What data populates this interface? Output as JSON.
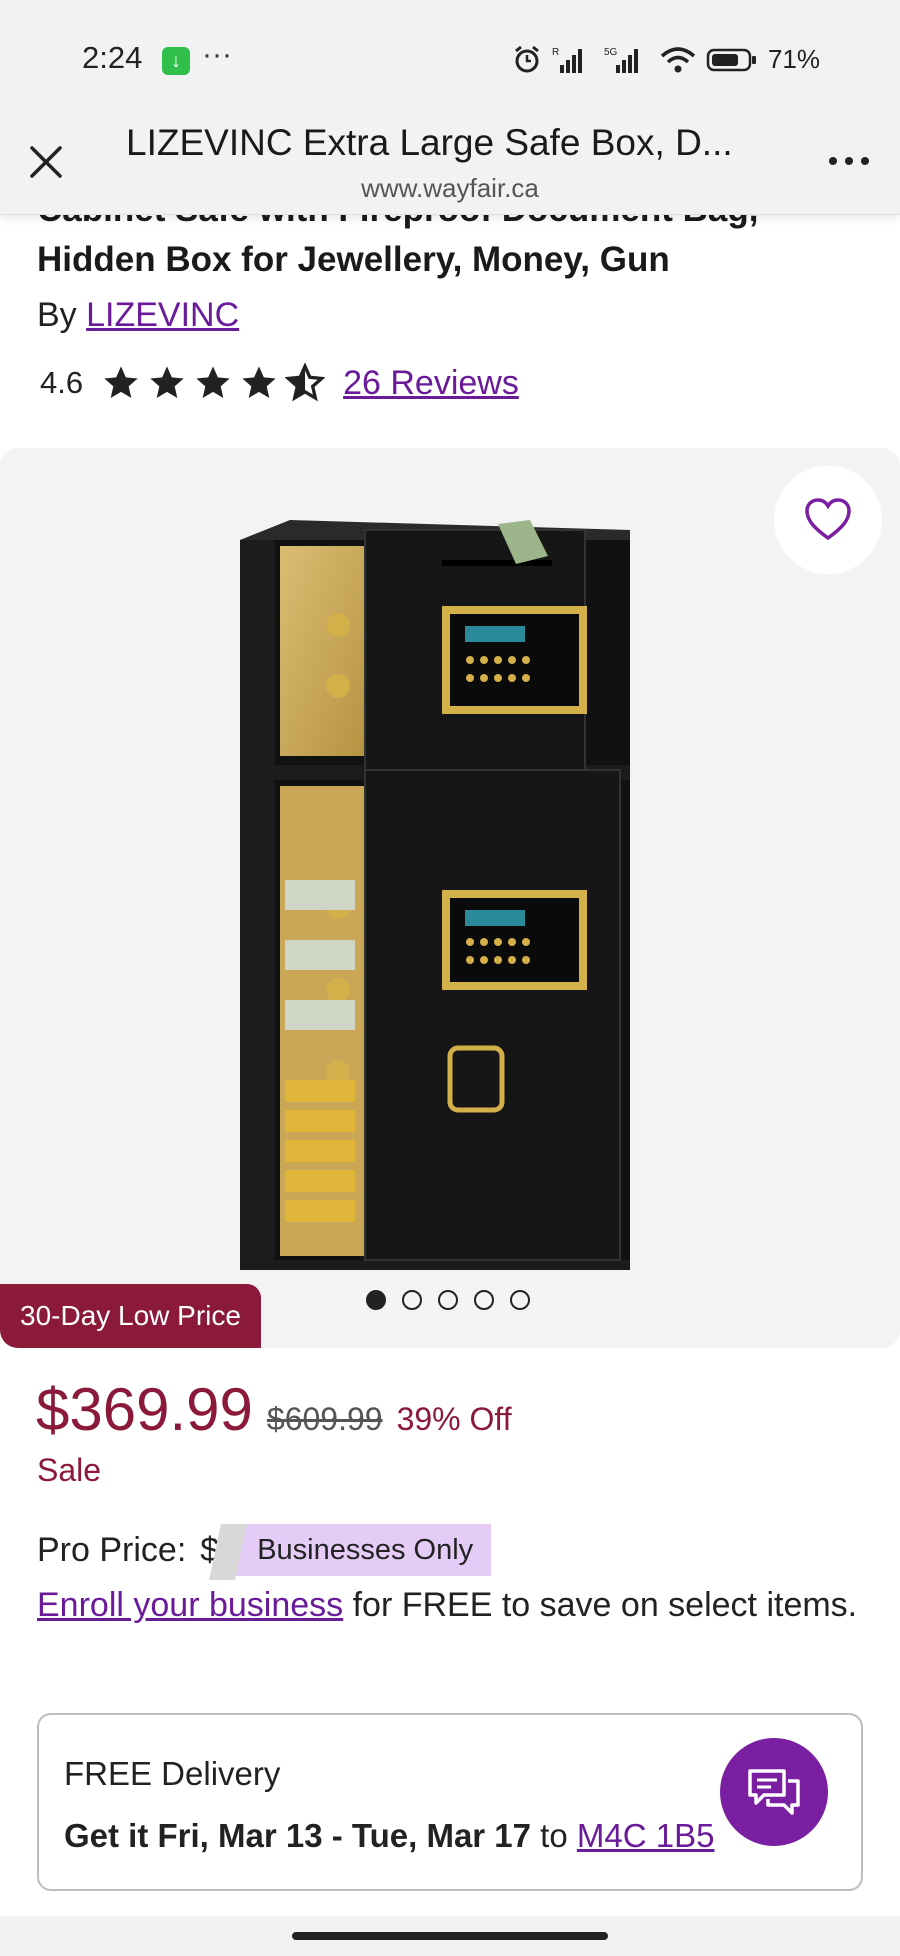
{
  "status_bar": {
    "time": "2:24",
    "battery": "71%",
    "network": "5G"
  },
  "header": {
    "title": "LIZEVINC Extra Large Safe Box, D...",
    "url": "www.wayfair.ca"
  },
  "product": {
    "title_visible": "Cabinet Safe with Fireproof Document Bag, Hidden Box for Jewellery, Money, Gun",
    "by_prefix": "By ",
    "brand": "LIZEVINC",
    "rating": "4.6",
    "stars_filled": 4.5,
    "reviews": "26 Reviews"
  },
  "gallery": {
    "badge": "30-Day Low Price",
    "dot_count": 5,
    "active_dot": 0
  },
  "pricing": {
    "price": "$369.99",
    "original_price": "$609.99",
    "discount": "39% Off",
    "sale_label": "Sale",
    "pro_label": "Pro Price:",
    "pro_dollar": "$",
    "businesses_only": "Businesses Only",
    "enroll_link": "Enroll your business",
    "enroll_text": " for FREE to save on select items."
  },
  "delivery": {
    "free_label": "FREE Delivery",
    "dates": "Get it Fri, Mar 13 - Tue, Mar 17",
    "to": " to ",
    "postal": "M4C 1B5"
  },
  "colors": {
    "brand_purple": "#7b1fa2",
    "link_purple": "#6a1b9a",
    "sale_red": "#8b1a3a",
    "badge_lavender": "#e5ccf6"
  },
  "icons": [
    "download-icon",
    "alarm-icon",
    "signal-icon",
    "wifi-icon",
    "battery-icon",
    "close-icon",
    "more-icon",
    "star-icon",
    "heart-icon",
    "chat-icon"
  ]
}
